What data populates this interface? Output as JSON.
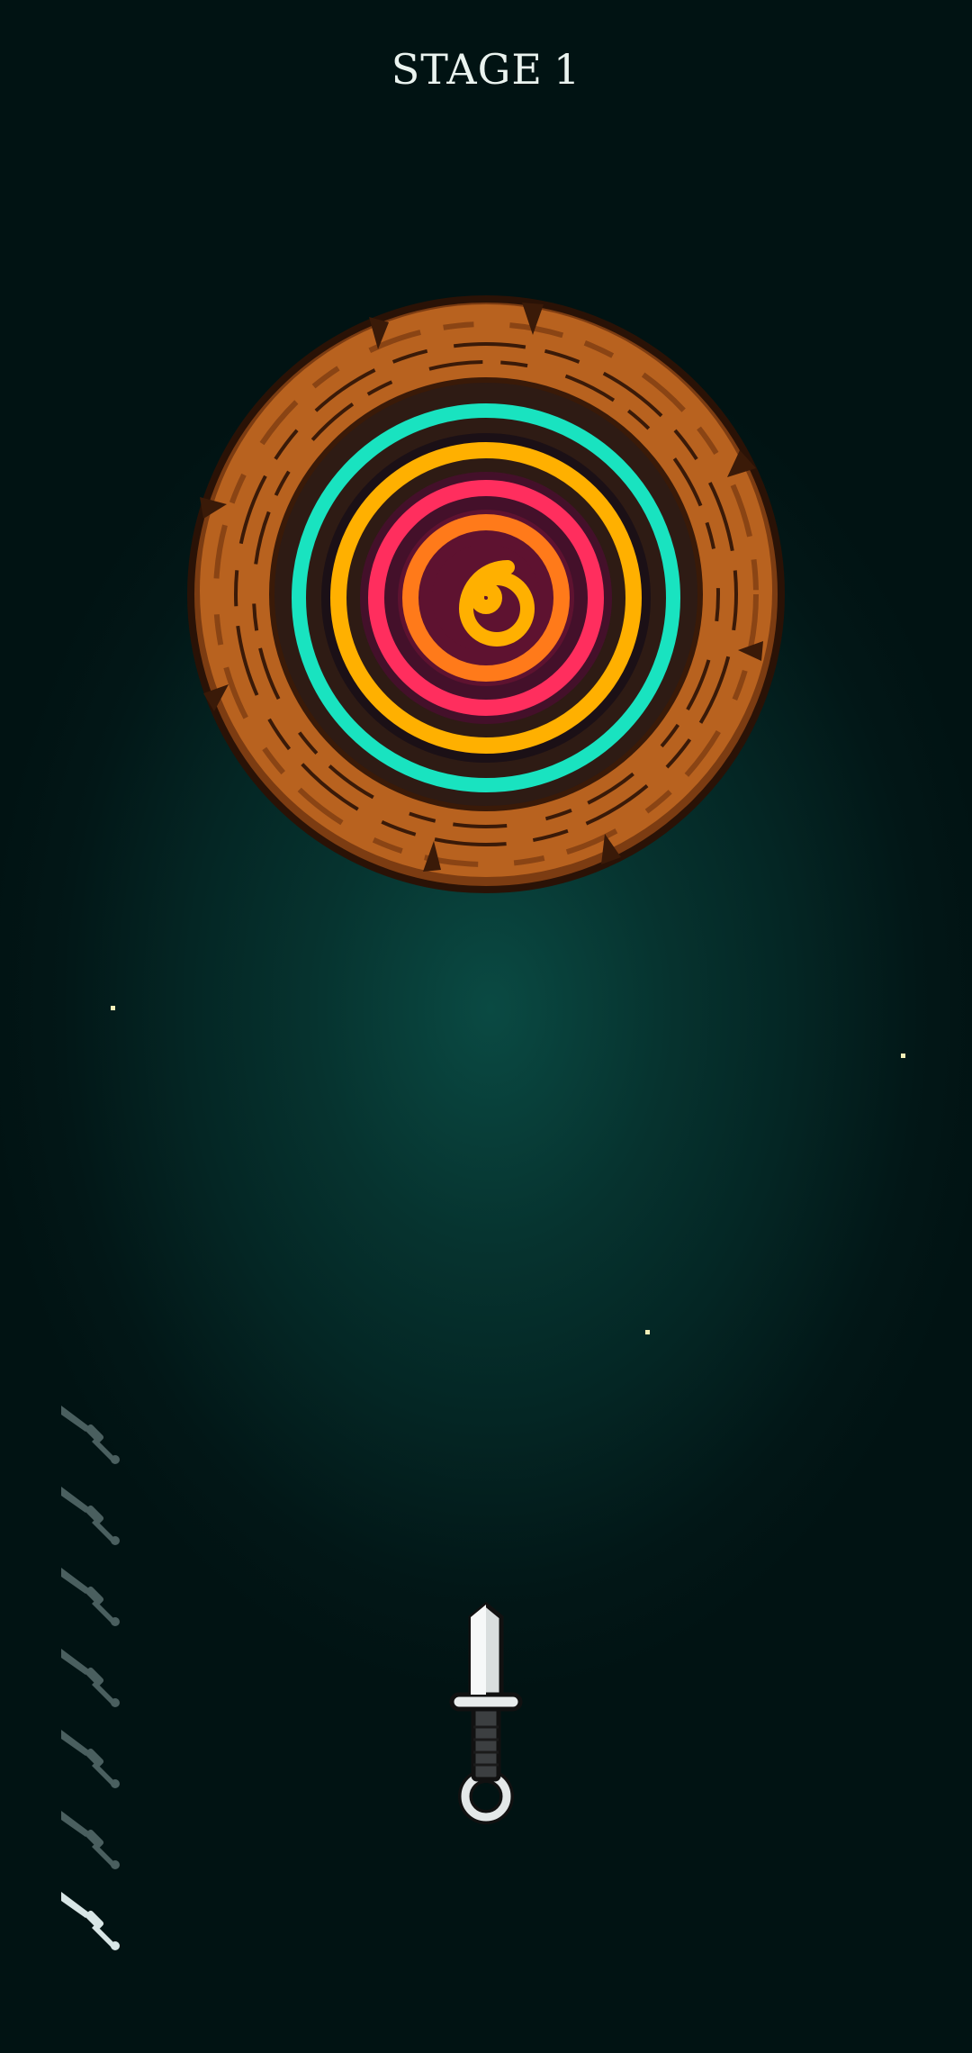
{
  "hud": {
    "stage_label": "STAGE",
    "stage_number": "1"
  },
  "colors": {
    "background": "#042624",
    "wood": "#b8621f",
    "wood_dark": "#7c3c12",
    "ring_teal": "#19e3c0",
    "ring_yellow": "#ffb000",
    "ring_pink": "#ff2e5e",
    "ring_orange": "#ff7a1a",
    "ring_gap": "#5e1230",
    "ammo_remaining": "#4a5f5f",
    "ammo_active": "#d8e6e6"
  },
  "target": {
    "type": "spinning-log",
    "stuck_knives": 6
  },
  "knives": {
    "remaining": 7,
    "active_index": 6
  },
  "icons": {
    "knife": "knife-icon",
    "ammo": "knife-ammo-icon"
  }
}
